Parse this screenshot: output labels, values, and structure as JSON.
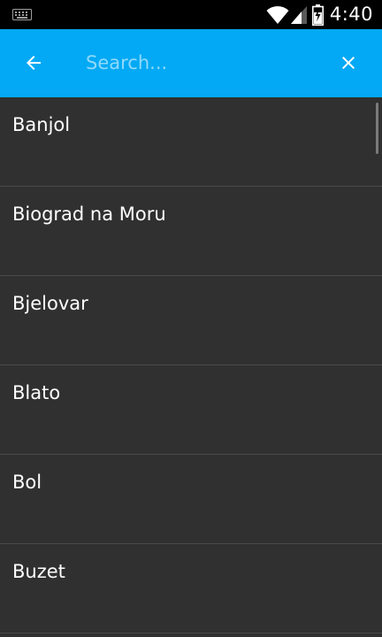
{
  "status_bar": {
    "time": "4:40",
    "icons": [
      "keyboard-icon",
      "wifi-icon",
      "signal-icon",
      "battery-charging-icon"
    ]
  },
  "app_bar": {
    "back_icon": "arrow-back-icon",
    "search_placeholder": "Search...",
    "search_value": "",
    "clear_icon": "close-icon",
    "background_color": "#03a9f4"
  },
  "list": {
    "items": [
      {
        "label": "Banjol"
      },
      {
        "label": "Biograd na Moru"
      },
      {
        "label": "Bjelovar"
      },
      {
        "label": "Blato"
      },
      {
        "label": "Bol"
      },
      {
        "label": "Buzet"
      }
    ]
  },
  "colors": {
    "list_background": "#303030",
    "divider": "#4a4a4a",
    "text": "#ffffff"
  }
}
